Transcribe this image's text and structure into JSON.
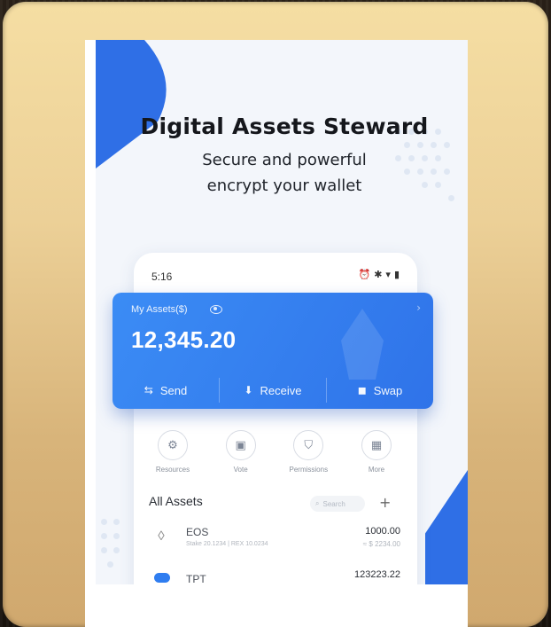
{
  "promo": {
    "headline": "Digital Assets Steward",
    "subline_1": "Secure and powerful",
    "subline_2": "encrypt your wallet"
  },
  "status_bar": {
    "time": "5:16"
  },
  "assets_card": {
    "label": "My Assets($)",
    "amount": "12,345.20",
    "actions": [
      {
        "label": "Send",
        "icon": "send-icon"
      },
      {
        "label": "Receive",
        "icon": "receive-icon"
      },
      {
        "label": "Swap",
        "icon": "swap-icon"
      }
    ]
  },
  "quick_actions": [
    {
      "label": "Resources",
      "icon": "resources-icon"
    },
    {
      "label": "Vote",
      "icon": "vote-icon"
    },
    {
      "label": "Permissions",
      "icon": "permissions-icon"
    },
    {
      "label": "More",
      "icon": "more-grid-icon"
    }
  ],
  "asset_list": {
    "title": "All Assets",
    "search_placeholder": "Search",
    "items": [
      {
        "name": "EOS",
        "meta": "Stake 20.1234 | REX 10.0234",
        "balance": "1000.00",
        "usd": "≈ $ 2234.00",
        "icon": "eos-icon"
      },
      {
        "name": "TPT",
        "meta": "",
        "balance": "123223.22",
        "usd": "",
        "icon": "tpt-icon"
      }
    ]
  },
  "colors": {
    "accent": "#2f73e9",
    "frame": "#ecd097"
  }
}
